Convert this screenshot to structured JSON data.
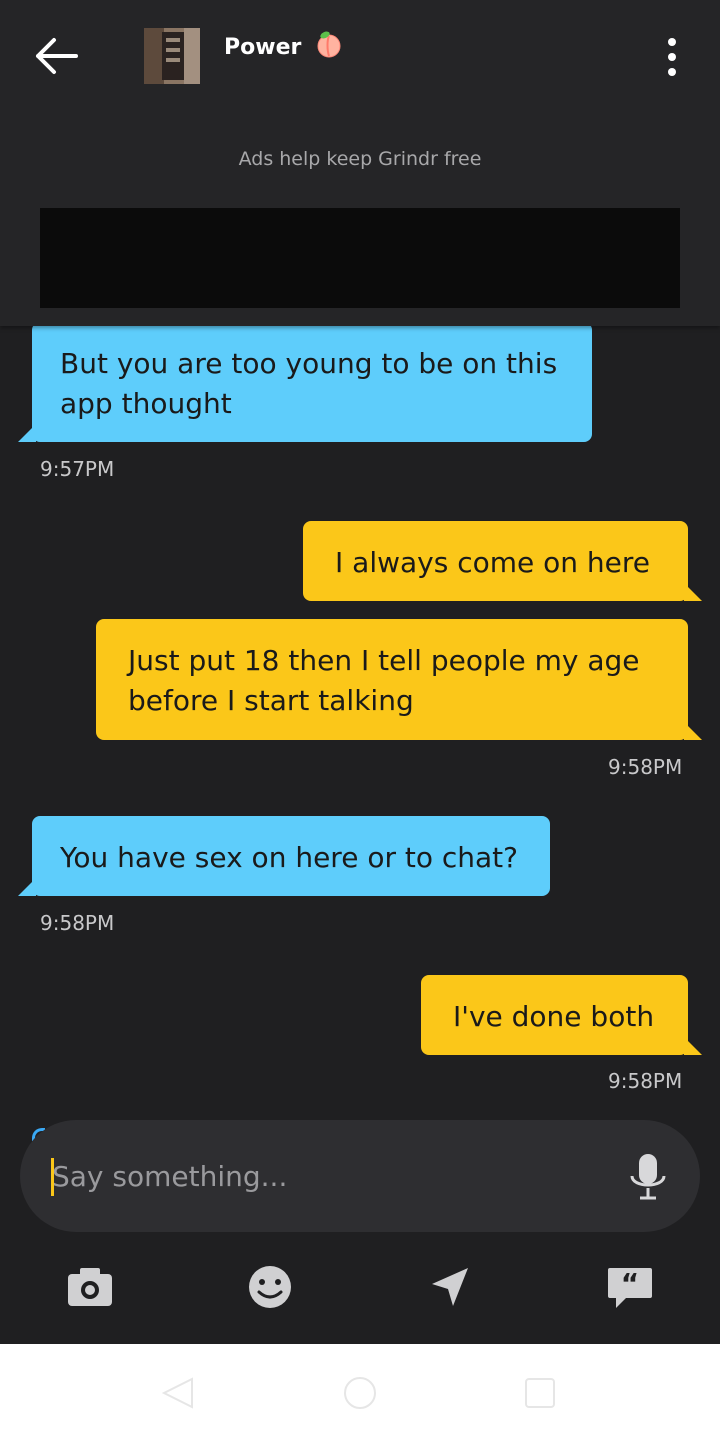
{
  "header": {
    "contact_name": "Power",
    "contact_emoji": "peach-icon",
    "back_icon": "arrow-left-icon",
    "menu_icon": "more-vertical-icon"
  },
  "ad": {
    "notice": "Ads help keep Grindr free"
  },
  "messages": [
    {
      "side": "received",
      "text_lines": [
        "But you are too young to be on this",
        "app thought"
      ],
      "time": "9:57PM"
    },
    {
      "side": "sent",
      "text_lines": [
        "I always come on here"
      ],
      "time": ""
    },
    {
      "side": "sent",
      "text_lines": [
        "Just put 18 then I tell people my age",
        "before I start talking"
      ],
      "time": "9:58PM"
    },
    {
      "side": "received",
      "text_lines": [
        "You have sex on here or to chat?"
      ],
      "time": "9:58PM"
    },
    {
      "side": "sent",
      "text_lines": [
        "I've done both"
      ],
      "time": "9:58PM"
    }
  ],
  "composer": {
    "placeholder": "Say something...",
    "mic_icon": "microphone-icon"
  },
  "toolbar": [
    "camera-icon",
    "emoji-icon",
    "location-icon",
    "saved-phrases-icon"
  ],
  "colors": {
    "received_bubble": "#5ecdfb",
    "sent_bubble": "#fbc719",
    "background": "#1f1f21"
  }
}
